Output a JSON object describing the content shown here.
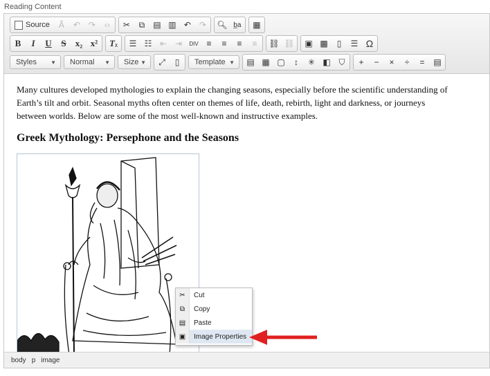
{
  "field_label": "Reading Content",
  "toolbar": {
    "source_label": "Source",
    "styles_label": "Styles",
    "format_label": "Normal",
    "size_label": "Size",
    "template_label": "Template",
    "row1_icons": [
      "cut-icon",
      "copy-icon",
      "paste-icon",
      "paste-text-icon",
      "undo-icon",
      "redo-icon",
      "find-icon",
      "replace-icon",
      "spellcheck-icon"
    ],
    "row2_icons": [
      "bold-icon",
      "italic-icon",
      "underline-icon",
      "strike-icon",
      "subscript-icon",
      "superscript-icon",
      "remove-format-icon",
      "numbered-list-icon",
      "bulleted-list-icon",
      "outdent-icon",
      "indent-icon",
      "div-icon",
      "align-left-icon",
      "align-center-icon",
      "align-right-icon",
      "justify-icon",
      "link-icon",
      "unlink-icon",
      "image-icon",
      "flash-icon",
      "page-icon",
      "hr-icon",
      "omega-icon"
    ]
  },
  "content": {
    "paragraph": "Many cultures developed mythologies to explain the changing seasons, especially before the scientific understanding of Earth’s tilt and orbit. Seasonal myths often center on themes of life, death, rebirth, light and darkness, or journeys between worlds. Below are some of the most well-known and instructive examples.",
    "heading": "Greek Mythology: Persephone and the Seasons"
  },
  "context_menu": {
    "items": [
      {
        "label": "Cut",
        "icon": "scissors-icon"
      },
      {
        "label": "Copy",
        "icon": "copy-icon"
      },
      {
        "label": "Paste",
        "icon": "paste-icon"
      },
      {
        "label": "Image Properties",
        "icon": "image-icon"
      }
    ]
  },
  "status_bar": {
    "path": [
      "body",
      "p",
      "image"
    ]
  },
  "colors": {
    "accent_arrow": "#e02020",
    "toolbar_bg": "#ececec",
    "menu_highlight": "#dfe8f2"
  }
}
